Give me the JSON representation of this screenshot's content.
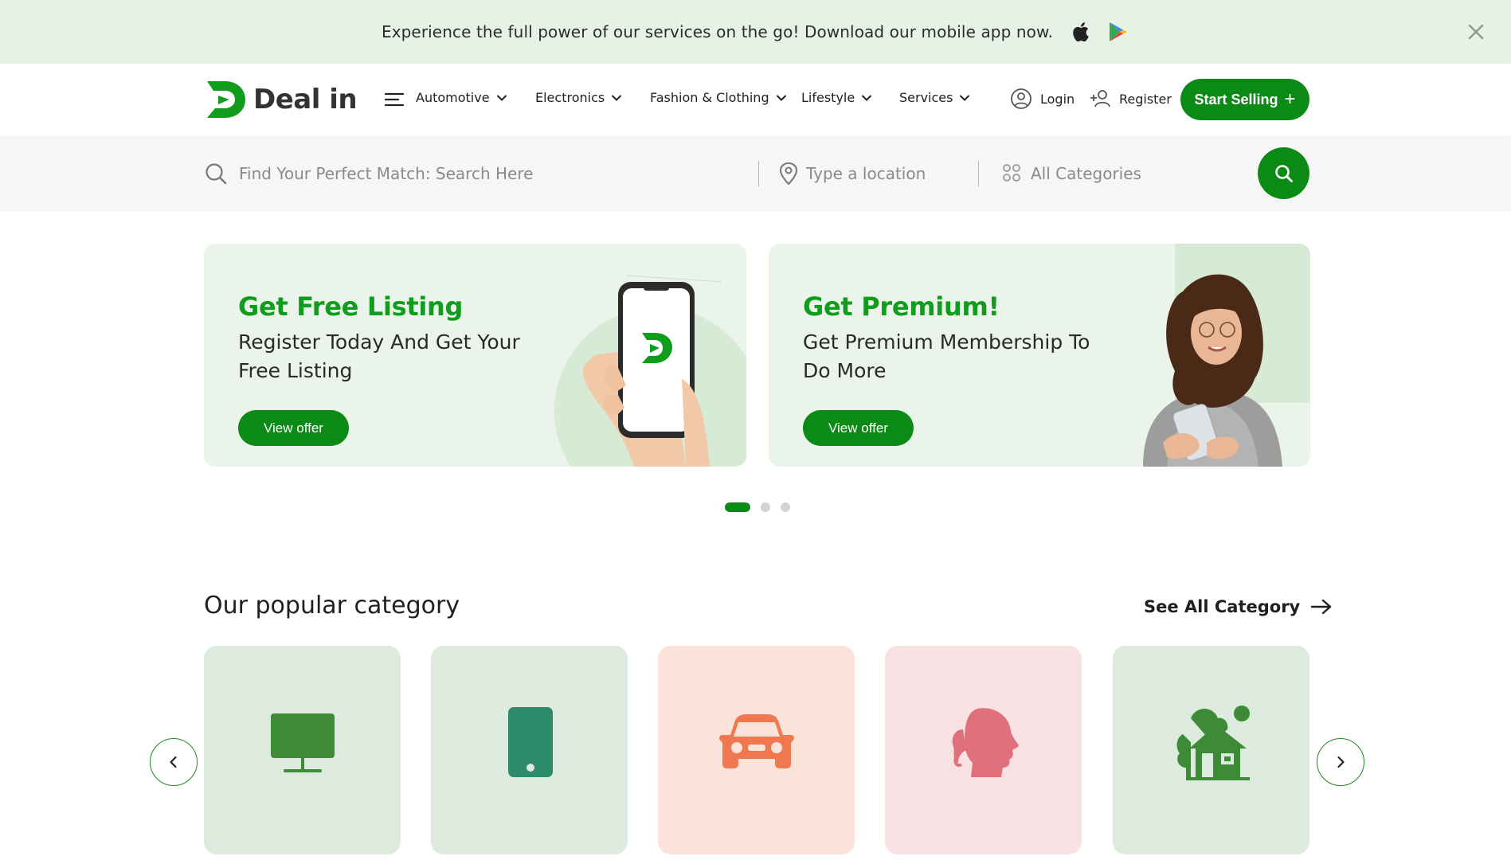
{
  "promo": {
    "text": "Experience the full power of our services on the go! Download our mobile app now.",
    "icons": [
      "apple-icon",
      "google-play-icon",
      "close-icon"
    ]
  },
  "header": {
    "logo_text": "Deal in",
    "nav": [
      {
        "label": "Automotive"
      },
      {
        "label": "Electronics"
      },
      {
        "label": "Fashion & Clothing"
      },
      {
        "label": "Lifestyle"
      },
      {
        "label": "Services"
      }
    ],
    "login_label": "Login",
    "register_label": "Register",
    "start_selling_label": "Start Selling"
  },
  "search": {
    "query_placeholder": "Find Your Perfect Match: Search Here",
    "location_placeholder": "Type a location",
    "category_label": "All Categories"
  },
  "offers": [
    {
      "title": "Get Free Listing",
      "subtitle": "Register Today And Get Your Free Listing",
      "button": "View offer"
    },
    {
      "title": "Get Premium!",
      "subtitle": "Get Premium Membership To Do More",
      "button": "View offer"
    }
  ],
  "carousel": {
    "dot_count": 3,
    "active_index": 0
  },
  "popular": {
    "title": "Our popular category",
    "see_all": "See All Category",
    "cards": [
      {
        "icon": "monitor-icon",
        "bg": "#dcebdd",
        "color": "#3d8b37"
      },
      {
        "icon": "phone-icon",
        "bg": "#dcebdd",
        "color": "#2e8b6a"
      },
      {
        "icon": "car-icon",
        "bg": "#fbe3d9",
        "color": "#f07850"
      },
      {
        "icon": "woman-head-icon",
        "bg": "#f8e1e3",
        "color": "#e0707c"
      },
      {
        "icon": "house-icon",
        "bg": "#dcebdd",
        "color": "#3d8b37"
      }
    ]
  },
  "colors": {
    "brand": "#0c8a16",
    "promo_bg": "#e6f2e6",
    "offer_bg": "#eaf4ea"
  }
}
